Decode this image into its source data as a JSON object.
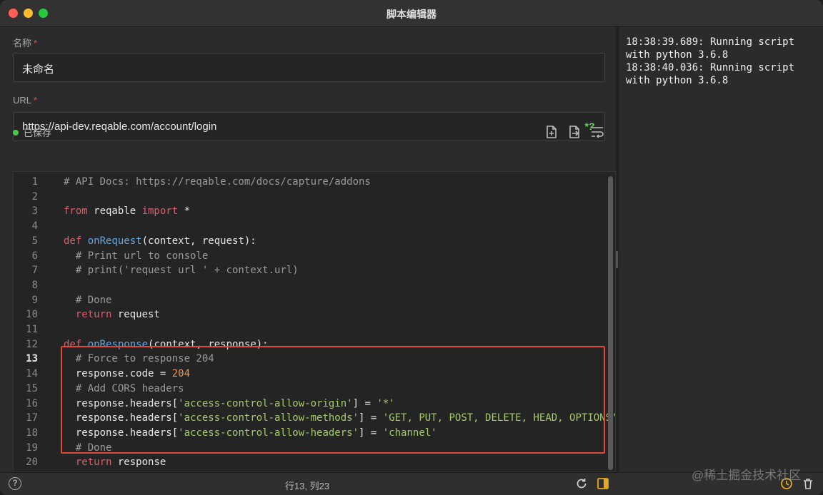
{
  "window": {
    "title": "脚本编辑器"
  },
  "form": {
    "name_label": "名称",
    "name_value": "未命名",
    "url_label": "URL",
    "url_value": "https://api-dev.reqable.com/account/login",
    "required_mark": "*",
    "regex_badge": "*?"
  },
  "status": {
    "saved_text": "已保存"
  },
  "toolbar_icons": [
    "new-file-icon",
    "export-file-icon",
    "wrap-text-icon"
  ],
  "editor": {
    "active_line": 13,
    "lines": [
      {
        "n": "1",
        "tokens": [
          {
            "t": "# API Docs: https://reqable.com/docs/capture/addons",
            "c": "cm"
          }
        ]
      },
      {
        "n": "2",
        "tokens": []
      },
      {
        "n": "3",
        "tokens": [
          {
            "t": "from",
            "c": "kw"
          },
          {
            "t": " reqable ",
            "c": ""
          },
          {
            "t": "import",
            "c": "kw"
          },
          {
            "t": " *",
            "c": ""
          }
        ]
      },
      {
        "n": "4",
        "tokens": []
      },
      {
        "n": "5",
        "tokens": [
          {
            "t": "def",
            "c": "kw"
          },
          {
            "t": " ",
            "c": ""
          },
          {
            "t": "onRequest",
            "c": "fn"
          },
          {
            "t": "(context, request):",
            "c": ""
          }
        ]
      },
      {
        "n": "6",
        "tokens": [
          {
            "t": "  # Print url to console",
            "c": "cm"
          }
        ]
      },
      {
        "n": "7",
        "tokens": [
          {
            "t": "  # print('request url ' + context.url)",
            "c": "cm"
          }
        ]
      },
      {
        "n": "8",
        "tokens": []
      },
      {
        "n": "9",
        "tokens": [
          {
            "t": "  # Done",
            "c": "cm"
          }
        ]
      },
      {
        "n": "10",
        "tokens": [
          {
            "t": "  ",
            "c": ""
          },
          {
            "t": "return",
            "c": "kw"
          },
          {
            "t": " request",
            "c": ""
          }
        ]
      },
      {
        "n": "11",
        "tokens": []
      },
      {
        "n": "12",
        "tokens": [
          {
            "t": "def",
            "c": "kw"
          },
          {
            "t": " ",
            "c": ""
          },
          {
            "t": "onResponse",
            "c": "fn"
          },
          {
            "t": "(context, response):",
            "c": ""
          }
        ]
      },
      {
        "n": "13",
        "tokens": [
          {
            "t": "  # Force to response 204",
            "c": "cm"
          }
        ]
      },
      {
        "n": "14",
        "tokens": [
          {
            "t": "  response.code = ",
            "c": ""
          },
          {
            "t": "204",
            "c": "nm"
          }
        ]
      },
      {
        "n": "15",
        "tokens": [
          {
            "t": "  # Add CORS headers",
            "c": "cm"
          }
        ]
      },
      {
        "n": "16",
        "tokens": [
          {
            "t": "  response.headers[",
            "c": ""
          },
          {
            "t": "'access-control-allow-origin'",
            "c": "st"
          },
          {
            "t": "] = ",
            "c": ""
          },
          {
            "t": "'*'",
            "c": "st"
          }
        ]
      },
      {
        "n": "17",
        "tokens": [
          {
            "t": "  response.headers[",
            "c": ""
          },
          {
            "t": "'access-control-allow-methods'",
            "c": "st"
          },
          {
            "t": "] = ",
            "c": ""
          },
          {
            "t": "'GET, PUT, POST, DELETE, HEAD, OPTIONS'",
            "c": "st"
          }
        ]
      },
      {
        "n": "18",
        "tokens": [
          {
            "t": "  response.headers[",
            "c": ""
          },
          {
            "t": "'access-control-allow-headers'",
            "c": "st"
          },
          {
            "t": "] = ",
            "c": ""
          },
          {
            "t": "'channel'",
            "c": "st"
          }
        ]
      },
      {
        "n": "19",
        "tokens": [
          {
            "t": "  # Done",
            "c": "cm"
          }
        ]
      },
      {
        "n": "20",
        "tokens": [
          {
            "t": "  ",
            "c": ""
          },
          {
            "t": "return",
            "c": "kw"
          },
          {
            "t": " response",
            "c": ""
          }
        ]
      }
    ]
  },
  "console": {
    "lines": [
      "18:38:39.689: Running script with python 3.6.8",
      "18:38:40.036: Running script with python 3.6.8"
    ]
  },
  "statusbar": {
    "cursor_position": "行13, 列23"
  },
  "watermark": "@稀土掘金技术社区",
  "colors": {
    "accent_green": "#4cc94c",
    "highlight_red": "#e04a3a",
    "clock_yellow": "#e5a823"
  }
}
